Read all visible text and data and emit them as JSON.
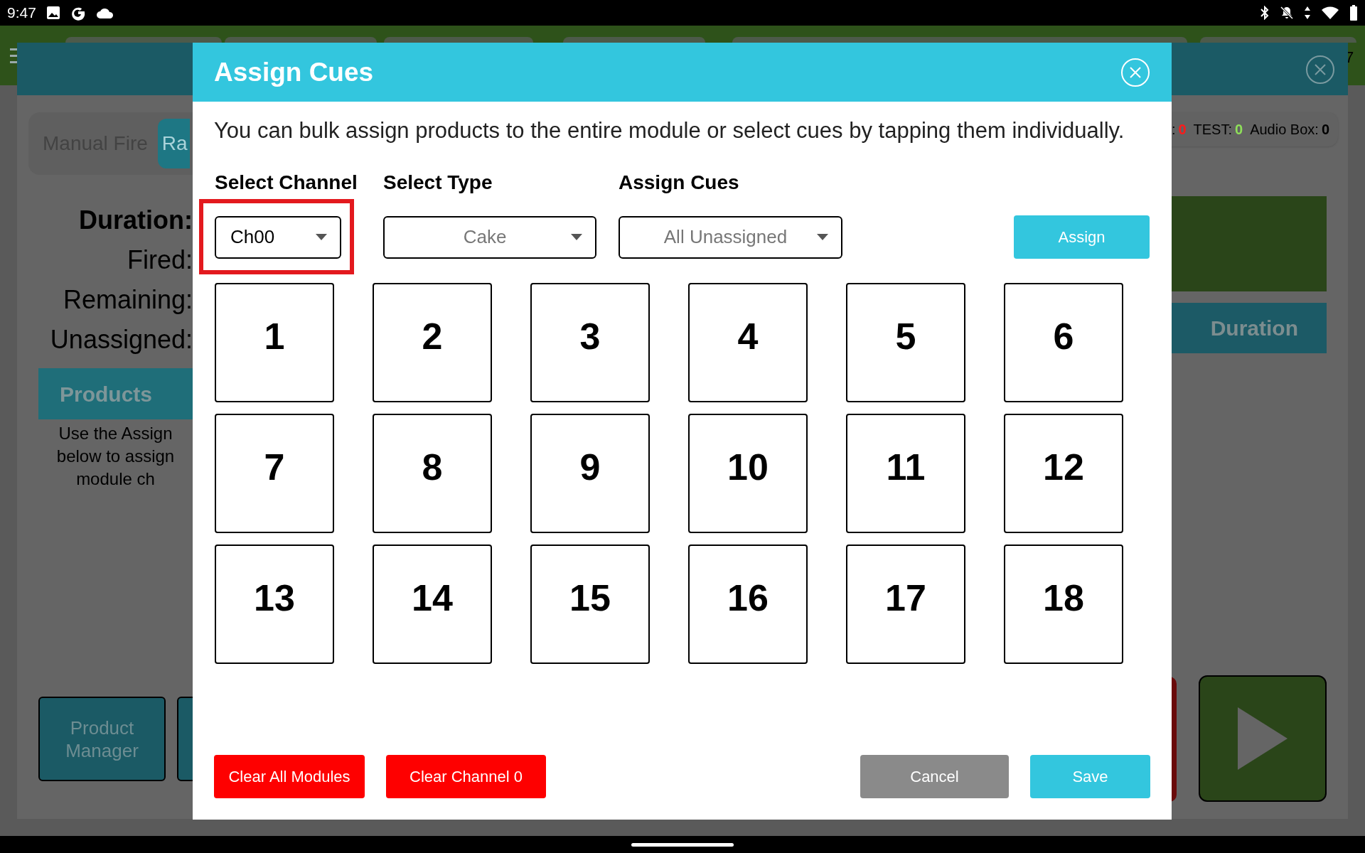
{
  "status_bar": {
    "time": "9:47"
  },
  "background": {
    "corner_text": "7",
    "tabs": [
      {
        "label": "Manual Fire",
        "selected": false
      },
      {
        "label": "Ra",
        "selected": true
      }
    ],
    "stats": [
      {
        "label": "Duration:",
        "bold": true
      },
      {
        "label": "Fired:",
        "bold": false
      },
      {
        "label": "Remaining:",
        "bold": false
      },
      {
        "label": "Unassigned:",
        "bold": false
      }
    ],
    "products_header": "Products",
    "products_hint": [
      "Use the Assign",
      "below to assign",
      "module ch"
    ],
    "counts": [
      {
        "label": ":",
        "value": "0",
        "color": "#ff1a1a"
      },
      {
        "label": "TEST:",
        "value": "0",
        "color": "#8fe05a"
      },
      {
        "label": "Audio Box:",
        "value": "0",
        "color": "#000000"
      }
    ],
    "duration_header": "Duration",
    "product_manager_button": "Product Manager"
  },
  "dialog": {
    "title": "Assign Cues",
    "description": "You can bulk assign products to the entire module or select cues by tapping them individually.",
    "selectors": [
      {
        "label": "Select Channel",
        "value": "Ch00",
        "highlighted": true,
        "disabled": false
      },
      {
        "label": "Select Type",
        "value": "Cake",
        "highlighted": false,
        "disabled": true
      },
      {
        "label": "Assign Cues",
        "value": "All Unassigned",
        "highlighted": false,
        "disabled": true
      }
    ],
    "assign_button": "Assign",
    "cues": [
      "1",
      "2",
      "3",
      "4",
      "5",
      "6",
      "7",
      "8",
      "9",
      "10",
      "11",
      "12",
      "13",
      "14",
      "15",
      "16",
      "17",
      "18"
    ],
    "buttons": [
      {
        "label": "Clear All Modules",
        "kind": "danger"
      },
      {
        "label": "Clear Channel 0",
        "kind": "danger"
      },
      {
        "label": "Cancel",
        "kind": "neutral"
      },
      {
        "label": "Save",
        "kind": "primary"
      }
    ]
  }
}
